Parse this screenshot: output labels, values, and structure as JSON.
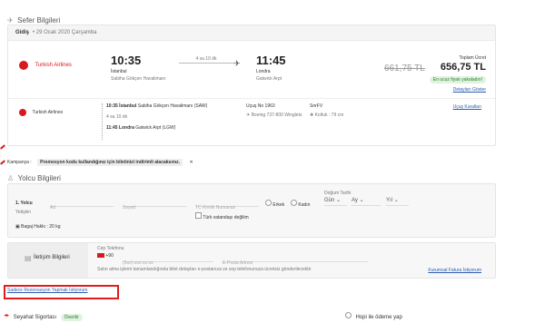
{
  "sefer": {
    "title": "Sefer Bilgileri",
    "date_label": "Gidiş",
    "date_value": "• 29 Ocak 2020 Çarşamba",
    "airline": "Turkish Airlines",
    "depart_time": "10:35",
    "depart_city": "İstanbul",
    "depart_airport": "Sabiha Gökçen Havalimanı",
    "duration": "4 sa 10 dk",
    "arrive_time": "11:45",
    "arrive_city": "Londra",
    "arrive_airport": "Gatwick Arpt",
    "total_label": "Toplam Ücret",
    "old_price": "661,75 TL",
    "price": "656,75 TL",
    "badge": "En ucuz fiyatı yakaladın!",
    "details_link": "Detayları Göster"
  },
  "leg": {
    "airline": "Turkish Airlines",
    "line1_time": "10:35 İstanbul",
    "line1_airport": "Sabiha Gökçen Havalimanı (SAW)",
    "line2_dur": "4 sa 10 dk",
    "line3_time": "11:45 Londra",
    "line3_airport": "Gatwick Arpt (LGW)",
    "flight_no": "Uçuş No 1963",
    "aircraft": "Boeing 737-800 Winglets",
    "class": "SnrFV",
    "seat": "Koltuk : 79 cm",
    "rules_link": "Uçuş Kuralları"
  },
  "kampanya": {
    "label": "Kampanya :",
    "text": "Promosyon kodu kullandığınız için biletinizi indirimli alacaksınız.",
    "close": "✕"
  },
  "yolcu": {
    "title": "Yolcu Bilgileri",
    "passenger_label": "1. Yolcu",
    "passenger_sub": "Yetişkin",
    "ad_placeholder": "Ad",
    "soyad_placeholder": "Soyad",
    "tc_placeholder": "TC Kimlik Numarası",
    "gender_male": "Erkek",
    "gender_female": "Kadın",
    "birth_label": "Doğum Tarihi",
    "day": "Gün",
    "month": "Ay",
    "year": "Yıl",
    "not_citizen": "Türk vatandaşı değilim",
    "baggage": "Bagaj Hakkı : 20 kg"
  },
  "iletisim": {
    "title": "İletişim Bilgileri",
    "phone_label": "Cep Telefonu",
    "country_code": "+90",
    "phone_placeholder": "(5xx)-xxx-xx-xx",
    "email_placeholder": "E-Posta Adresi",
    "info": "Satın alma işlemi tamamlandığında bilet detayları e-postanıza ve cep telefonunuza ücretsiz gönderilecektir",
    "invoice_link": "Kurumsal Fatura İstiyorum"
  },
  "reserve_link": "Sadece Rezervasyon Yapmak İstiyorum",
  "sigorta": {
    "title": "Seyahat Sigortası",
    "badge": "Önerilir"
  },
  "hopi": {
    "text": "Hopi ile ödeme yap"
  },
  "colors": {
    "brand_red": "#d71920",
    "link_blue": "#2a5db0",
    "highlight_red": "#e21c1c"
  }
}
